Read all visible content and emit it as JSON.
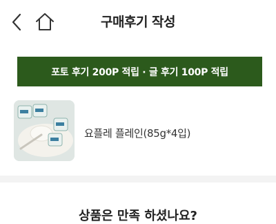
{
  "header": {
    "title": "구매후기 작성",
    "back_icon": "chevron-left-icon",
    "home_icon": "home-icon"
  },
  "banner": {
    "text": "포토 후기 200P 적립 · 글 후기 100P 적립",
    "background_color": "#2c5a1c"
  },
  "product": {
    "name": "요플레 플레인(85g*4입)"
  },
  "review": {
    "question": "상품은 만족 하셨나요?"
  }
}
